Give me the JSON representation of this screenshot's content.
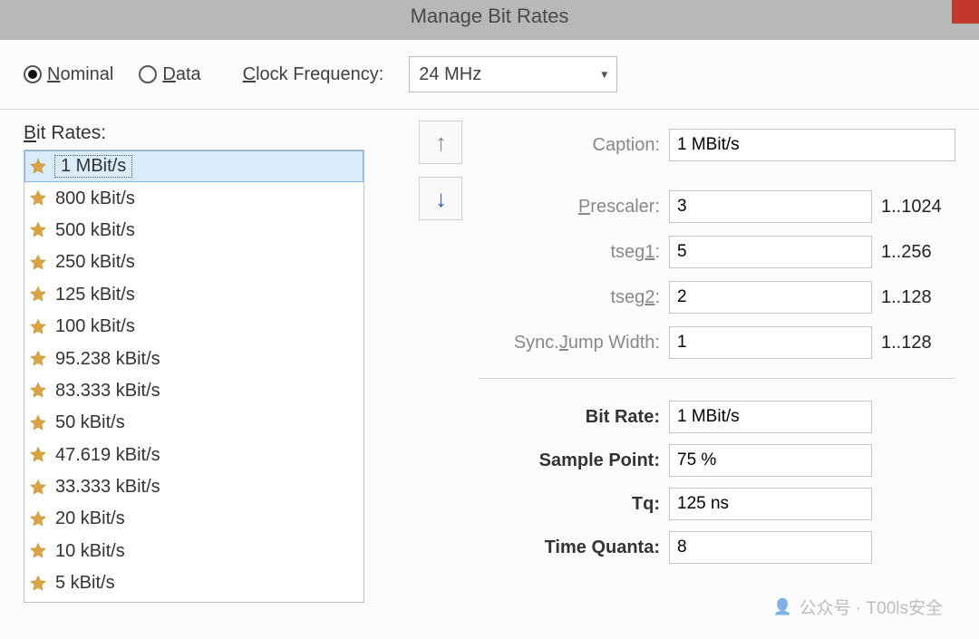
{
  "window": {
    "title": "Manage Bit Rates"
  },
  "toolbar": {
    "nominal_label": "Nominal",
    "data_label": "Data",
    "selected": "nominal",
    "clock_freq_label": "Clock Frequency:",
    "clock_freq_value": "24 MHz"
  },
  "list": {
    "label": "Bit Rates:",
    "selected_index": 0,
    "items": [
      "1 MBit/s",
      "800 kBit/s",
      "500 kBit/s",
      "250 kBit/s",
      "125 kBit/s",
      "100 kBit/s",
      "95.238 kBit/s",
      "83.333 kBit/s",
      "50 kBit/s",
      "47.619 kBit/s",
      "33.333 kBit/s",
      "20 kBit/s",
      "10 kBit/s",
      "5 kBit/s"
    ]
  },
  "move": {
    "up_enabled": false,
    "down_enabled": true
  },
  "params": {
    "caption_label": "Caption:",
    "caption_value": "1 MBit/s",
    "prescaler_label": "Prescaler:",
    "prescaler_value": "3",
    "prescaler_range": "1..1024",
    "tseg1_label": "tseg1:",
    "tseg1_value": "5",
    "tseg1_range": "1..256",
    "tseg2_label": "tseg2:",
    "tseg2_value": "2",
    "tseg2_range": "1..128",
    "sjw_label": "Sync.Jump Width:",
    "sjw_value": "1",
    "sjw_range": "1..128"
  },
  "results": {
    "bitrate_label": "Bit Rate:",
    "bitrate_value": "1 MBit/s",
    "sample_label": "Sample Point:",
    "sample_value": "75 %",
    "tq_label": "Tq:",
    "tq_value": "125 ns",
    "timequanta_label": "Time Quanta:",
    "timequanta_value": "8"
  },
  "watermark": {
    "text": "公众号 · T00ls安全"
  }
}
